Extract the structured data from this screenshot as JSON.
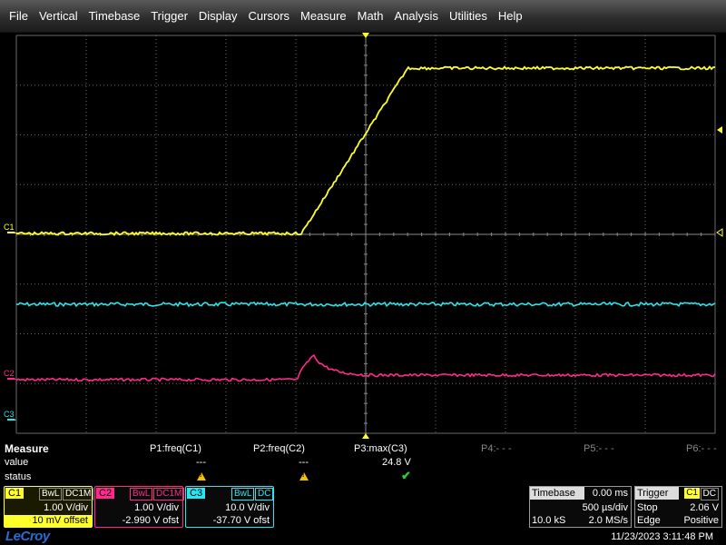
{
  "menu": [
    "File",
    "Vertical",
    "Timebase",
    "Trigger",
    "Display",
    "Cursors",
    "Measure",
    "Math",
    "Analysis",
    "Utilities",
    "Help"
  ],
  "colors": {
    "c1": "#ffff2a",
    "c2": "#ff2a8c",
    "c3": "#2ae6f0",
    "grid": "#6a6a6a"
  },
  "traces": {
    "c1": {
      "label": "C1",
      "points": [
        [
          0,
          0.0
        ],
        [
          0.408,
          0.0
        ],
        [
          0.56,
          1.0
        ],
        [
          1.0,
          1.0
        ]
      ]
    },
    "c2": {
      "label": "C2"
    },
    "c3": {
      "label": "C3"
    }
  },
  "measure": {
    "title": "Measure",
    "row_labels": [
      "value",
      "status"
    ],
    "params": [
      {
        "name": "P1:freq(C1)",
        "value": "---",
        "status": "warn"
      },
      {
        "name": "P2:freq(C2)",
        "value": "---",
        "status": "warn"
      },
      {
        "name": "P3:max(C3)",
        "value": "24.8 V",
        "status": "ok"
      },
      {
        "name": "P4:- - -",
        "value": "",
        "status": ""
      },
      {
        "name": "P5:- - -",
        "value": "",
        "status": ""
      },
      {
        "name": "P6:- - -",
        "value": "",
        "status": ""
      }
    ]
  },
  "channels": [
    {
      "id": "C1",
      "bw": "BwL",
      "coupling": "DC1M",
      "vdiv": "1.00 V/div",
      "offset": "10 mV offset"
    },
    {
      "id": "C2",
      "bw": "BwL",
      "coupling": "DC1M",
      "vdiv": "1.00 V/div",
      "offset": "-2.990 V ofst"
    },
    {
      "id": "C3",
      "bw": "BwL",
      "coupling": "DC",
      "vdiv": "10.0 V/div",
      "offset": "-37.70 V ofst"
    }
  ],
  "timebase": {
    "label": "Timebase",
    "delay": "0.00 ms",
    "tdiv": "500 µs/div",
    "samples": "10.0 kS",
    "rate": "2.0 MS/s"
  },
  "trigger": {
    "label": "Trigger",
    "source": "C1",
    "coupling": "DC",
    "mode": "Stop",
    "level": "2.06 V",
    "type": "Edge",
    "slope": "Positive"
  },
  "footer": {
    "logo": "LeCroy",
    "datetime": "11/23/2023 3:11:48 PM"
  }
}
